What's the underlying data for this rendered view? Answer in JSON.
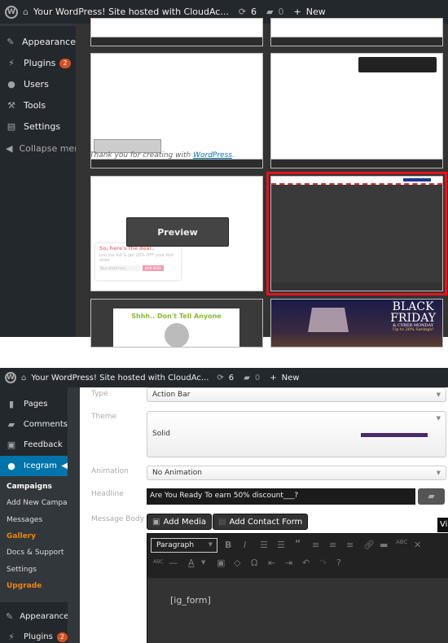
{
  "top": {
    "adminbar": {
      "site_title": "Your WordPress! Site hosted with CloudAc...",
      "updates": "6",
      "comments": "0",
      "new_label": "New"
    },
    "sidebar": [
      {
        "label": "Appearance",
        "icon": "paintbrush-icon"
      },
      {
        "label": "Plugins",
        "icon": "plugin-icon",
        "badge": "2"
      },
      {
        "label": "Users",
        "icon": "user-icon"
      },
      {
        "label": "Tools",
        "icon": "wrench-icon"
      },
      {
        "label": "Settings",
        "icon": "settings-icon"
      },
      {
        "label": "Collapse menu",
        "icon": "collapse-icon"
      }
    ],
    "gallery": {
      "footer_text": "Thank you for creating with ",
      "footer_link": "WordPress",
      "preview_label": "Preview",
      "popup_title": "So, here's the deal..",
      "popup_text": "Join our list & get 20% OFF your first order",
      "popup_placeholder": "Your email here",
      "popup_button": "JOIN NOW",
      "shhh_title": "Shhh.. Don't Tell Anyone",
      "bf_title1": "BLACK",
      "bf_title2": "FRIDAY",
      "bf_sub": "& CYBER MONDAY",
      "bf_sub2": "Up to 20% Savings!",
      "selected_border": "#e0141e"
    }
  },
  "bottom": {
    "adminbar": {
      "site_title": "Your WordPress! Site hosted with CloudAc...",
      "updates": "6",
      "comments": "0",
      "new_label": "New"
    },
    "sidebar": {
      "items": [
        {
          "label": "Pages",
          "icon": "pages-icon"
        },
        {
          "label": "Comments",
          "icon": "comment-icon"
        },
        {
          "label": "Feedback",
          "icon": "feedback-icon"
        }
      ],
      "active": {
        "label": "Icegram",
        "icon": "icegram-icon",
        "color": "#0073aa"
      },
      "submenu": [
        "Campaigns",
        "Add New Campaign",
        "Messages",
        "Gallery",
        "Docs & Support",
        "Settings",
        "Upgrade"
      ],
      "after": [
        {
          "label": "Appearance",
          "icon": "paintbrush-icon"
        },
        {
          "label": "Plugins",
          "icon": "plugin-icon",
          "badge": "2"
        }
      ],
      "highlight_color": "#f18500"
    },
    "form": {
      "type_label": "Type",
      "type_value": "Action Bar",
      "theme_label": "Theme",
      "theme_value": "Solid",
      "animation_label": "Animation",
      "animation_value": "No Animation",
      "headline_label": "Headline",
      "headline_value": "Are You Ready To earn 50% discount___?",
      "body_label": "Message Body",
      "add_media": "Add Media",
      "add_contact_form": "Add Contact Form",
      "visual_tab": "Vi",
      "format_value": "Paragraph",
      "editor_content": "[ig_form]"
    }
  }
}
